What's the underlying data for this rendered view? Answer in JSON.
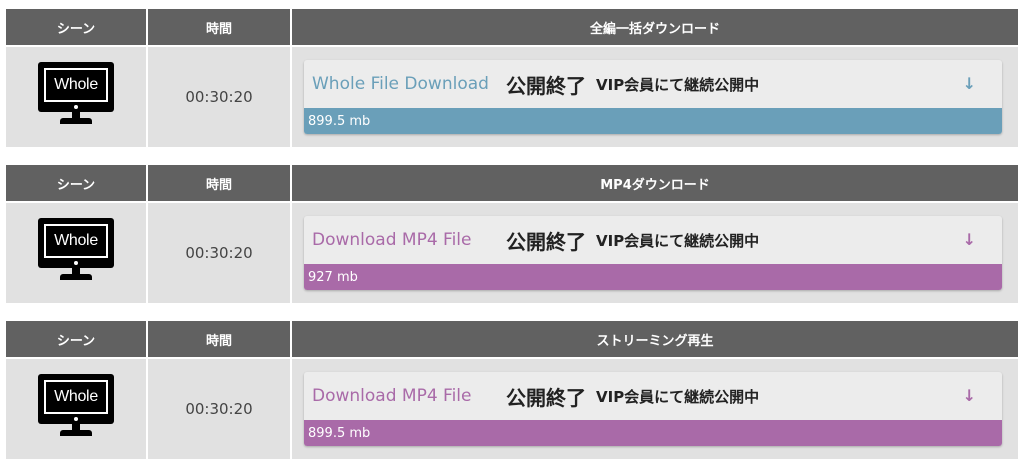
{
  "colors": {
    "header_bg": "#616161",
    "cell_bg": "#e1e1e1",
    "blue_accent": "#6a9fb9",
    "purple_accent": "#a96aa8"
  },
  "sections": [
    {
      "header": {
        "scene": "シーン",
        "time": "時間",
        "download": "全編一括ダウンロード"
      },
      "thumbnail_text": "Whole",
      "time": "00:30:20",
      "button": {
        "label": "Whole File Download",
        "ended": "公開終了",
        "vip": "VIP会員にて継続公開中",
        "arrow": "↓",
        "size": "899.5 mb",
        "accent": "#6a9fb9",
        "icon": "download-arrow-icon"
      }
    },
    {
      "header": {
        "scene": "シーン",
        "time": "時間",
        "download": "MP4ダウンロード"
      },
      "thumbnail_text": "Whole",
      "time": "00:30:20",
      "button": {
        "label": "Download MP4 File",
        "ended": "公開終了",
        "vip": "VIP会員にて継続公開中",
        "arrow": "↓",
        "size": "927 mb",
        "accent": "#a96aa8",
        "icon": "download-arrow-icon"
      }
    },
    {
      "header": {
        "scene": "シーン",
        "time": "時間",
        "download": "ストリーミング再生"
      },
      "thumbnail_text": "Whole",
      "time": "00:30:20",
      "button": {
        "label": "Download MP4 File",
        "ended": "公開終了",
        "vip": "VIP会員にて継続公開中",
        "arrow": "↓",
        "size": "899.5 mb",
        "accent": "#a96aa8",
        "icon": "download-arrow-icon"
      }
    }
  ]
}
